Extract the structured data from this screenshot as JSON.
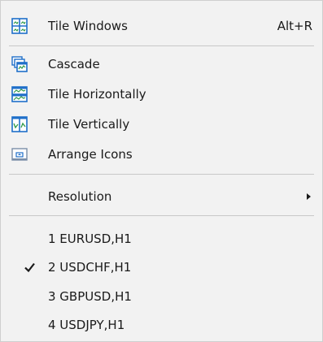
{
  "menu": {
    "items": [
      {
        "label": "Tile Windows",
        "shortcut": "Alt+R",
        "icon": "tile-windows-icon"
      },
      {
        "label": "Cascade",
        "icon": "cascade-icon"
      },
      {
        "label": "Tile Horizontally",
        "icon": "tile-horizontally-icon"
      },
      {
        "label": "Tile Vertically",
        "icon": "tile-vertically-icon"
      },
      {
        "label": "Arrange Icons",
        "icon": "arrange-icons-icon"
      },
      {
        "label": "Resolution",
        "icon": "submenu-arrow-icon"
      },
      {
        "label": "1 EURUSD,H1"
      },
      {
        "label": "2 USDCHF,H1",
        "checked": true
      },
      {
        "label": "3 GBPUSD,H1"
      },
      {
        "label": "4 USDJPY,H1"
      }
    ]
  },
  "colors": {
    "background": "#f2f2f2",
    "icon_blue": "#1f6fc9",
    "icon_green": "#2f9a4a",
    "separator": "#c8c8c8"
  }
}
